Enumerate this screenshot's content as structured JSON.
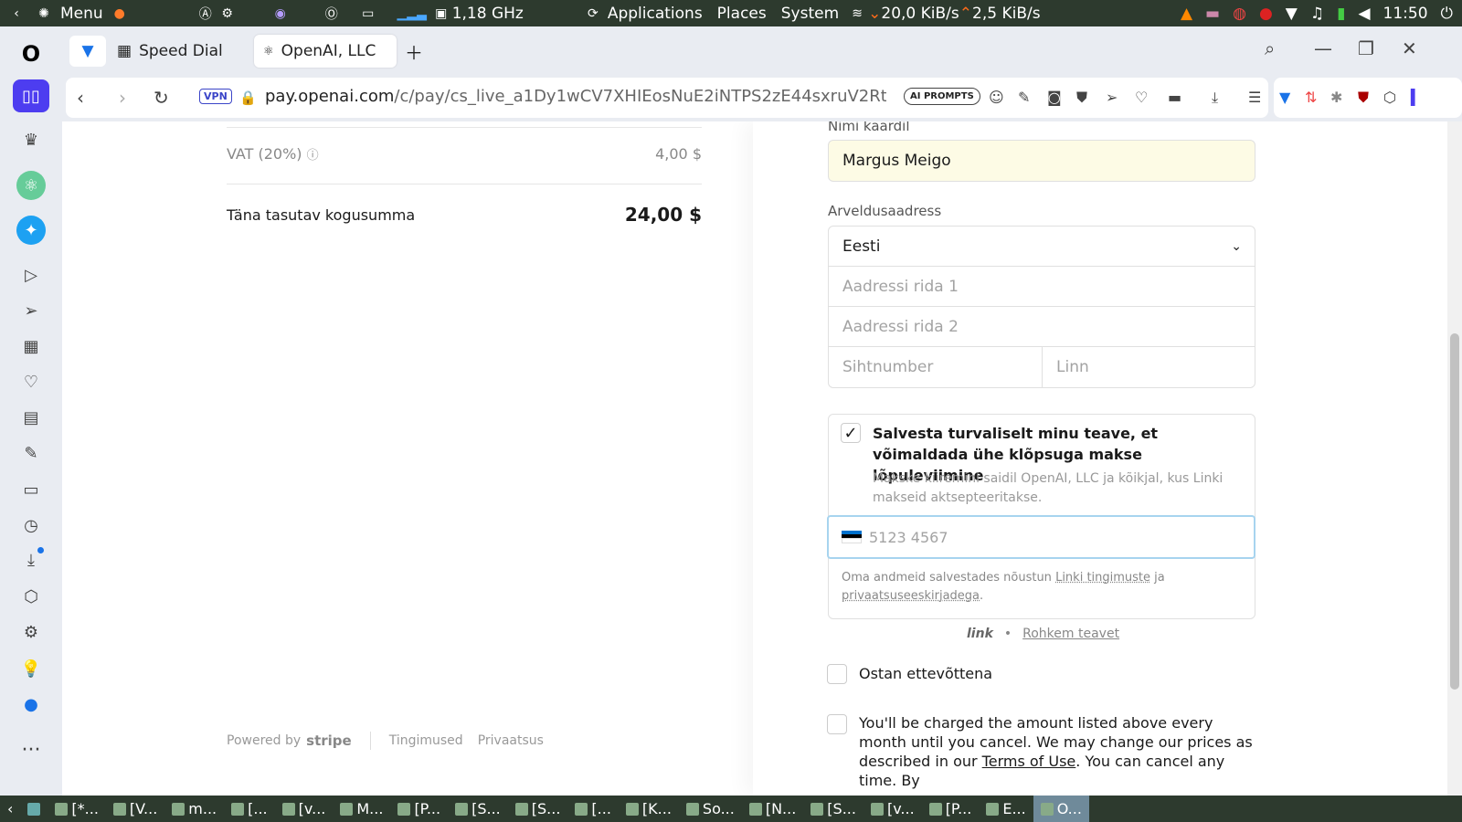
{
  "system_panel": {
    "menu_label": "Menu",
    "cpu_freq": "1,18 GHz",
    "applications": "Applications",
    "places": "Places",
    "system": "System",
    "net_down": "20,0 KiB/s",
    "net_up": "2,5 KiB/s",
    "clock": "11:50"
  },
  "tabs": [
    {
      "label": "Speed Dial"
    },
    {
      "label": "OpenAI, LLC"
    }
  ],
  "address_bar": {
    "vpn_label": "VPN",
    "url_domain": "pay.openai.com",
    "url_path": "/c/pay/cs_live_a1Dy1wCV7XHIEosNuE2iNTPS2zE44sxruV2Rt",
    "ai_prompts_label": "AI PROMPTS"
  },
  "summary": {
    "vat_label": "VAT (20%)",
    "vat_amount": "4,00 $",
    "total_label": "Täna tasutav kogusumma",
    "total_amount": "24,00 $"
  },
  "footer": {
    "powered_by": "Powered by",
    "stripe": "stripe",
    "terms": "Tingimused",
    "privacy": "Privaatsus"
  },
  "form": {
    "card_name_label": "Nimi kaardil",
    "card_name_value": "Margus Meigo",
    "billing_label": "Arveldusaadress",
    "country_value": "Eesti",
    "address1_placeholder": "Aadressi rida 1",
    "address2_placeholder": "Aadressi rida 2",
    "postal_placeholder": "Sihtnumber",
    "city_placeholder": "Linn",
    "save_info_title": "Salvesta turvaliselt minu teave, et võimaldada ühe klõpsuga makse lõpuleviimine",
    "save_info_desc": "Makske kiiremini saidil OpenAI, LLC ja kõikjal, kus Linki makseid aktsepteeritakse.",
    "phone_placeholder": "5123 4567",
    "terms_prefix": "Oma andmeid salvestades nõustun",
    "terms_link": "Linki tingimuste",
    "terms_mid": "ja",
    "privacy_link": "privaatsuseeskirjadega",
    "link_logo": "link",
    "learn_more": "Rohkem teavet",
    "business_label": "Ostan ettevõttena",
    "charge_text": "You'll be charged the amount listed above every month until you cancel. We may change our prices as described in our",
    "charge_terms_link": "Terms of Use",
    "charge_text_end": ". You can cancel any time. By"
  },
  "taskbar": [
    {
      "label": "[*..."
    },
    {
      "label": "[V..."
    },
    {
      "label": "m..."
    },
    {
      "label": "[..."
    },
    {
      "label": "[v..."
    },
    {
      "label": "M..."
    },
    {
      "label": "[P..."
    },
    {
      "label": "[S..."
    },
    {
      "label": "[S..."
    },
    {
      "label": "[..."
    },
    {
      "label": "[K..."
    },
    {
      "label": "So..."
    },
    {
      "label": "[N..."
    },
    {
      "label": "[S..."
    },
    {
      "label": "[v..."
    },
    {
      "label": "[P..."
    },
    {
      "label": "E..."
    },
    {
      "label": "O..."
    }
  ]
}
